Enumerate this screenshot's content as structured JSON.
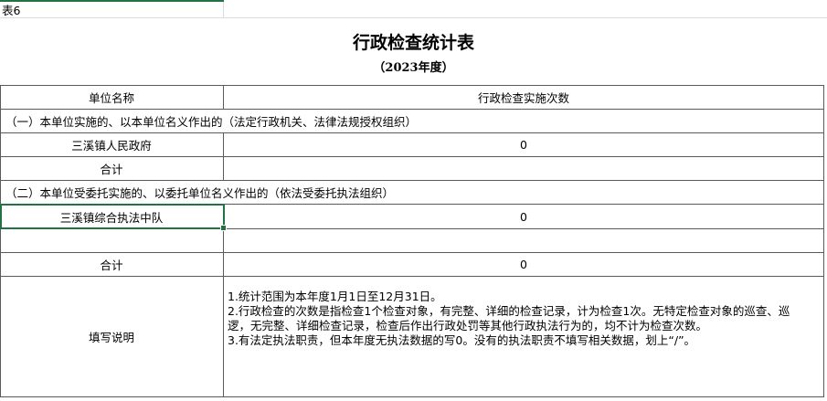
{
  "sheet_label": "表6",
  "title": "行政检查统计表",
  "subtitle": "（2023年度）",
  "header": {
    "unit_name": "单位名称",
    "count": "行政检查实施次数"
  },
  "section1": {
    "heading": "（一）本单位实施的、以本单位名义作出的（法定行政机关、法律法规授权组织）",
    "rows": [
      {
        "name": "三溪镇人民政府",
        "value": "0"
      },
      {
        "name": "合计",
        "value": ""
      }
    ]
  },
  "section2": {
    "heading": "（二）本单位受委托实施的、以委托单位名义作出的（依法受委托执法组织）",
    "rows": [
      {
        "name": "三溪镇综合执法中队",
        "value": "0"
      },
      {
        "name": "",
        "value": ""
      },
      {
        "name": "合计",
        "value": "0"
      }
    ]
  },
  "notes": {
    "label": "填写说明",
    "lines": [
      "1.统计范围为本年度1月1日至12月31日。",
      "2.行政检查的次数是指检查1个检查对象，有完整、详细的检查记录，计为检查1次。无特定检查对象的巡查、巡逻，无完整、详细检查记录，检查后作出行政处罚等其他行政执法行为的，均不计为检查次数。",
      "3.有法定执法职责，但本年度无执法数据的写0。没有的执法职责不填写相关数据，划上“/”。"
    ]
  },
  "colors": {
    "selection": "#217346"
  }
}
